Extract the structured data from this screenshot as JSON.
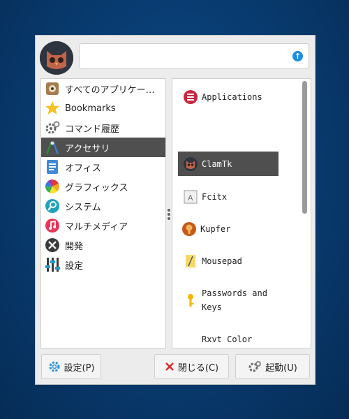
{
  "search": {
    "value": "",
    "placeholder": ""
  },
  "categories": [
    {
      "label": "すべてのアプリケー…",
      "icon": "all-apps-icon"
    },
    {
      "label": "Bookmarks",
      "icon": "star-icon"
    },
    {
      "label": "コマンド履歴",
      "icon": "gears-icon"
    },
    {
      "label": "アクセサリ",
      "icon": "accessories-icon",
      "selected": true
    },
    {
      "label": "オフィス",
      "icon": "office-icon"
    },
    {
      "label": "グラフィックス",
      "icon": "color-wheel-icon"
    },
    {
      "label": "システム",
      "icon": "magnifier-icon"
    },
    {
      "label": "マルチメディア",
      "icon": "music-note-icon"
    },
    {
      "label": "開発",
      "icon": "tools-icon"
    },
    {
      "label": "設定",
      "icon": "sliders-icon"
    }
  ],
  "apps": [
    {
      "label": "Applications",
      "icon": "applications-icon"
    },
    {
      "label": "ClamTk",
      "icon": "clamtk-icon",
      "selected": true
    },
    {
      "label": "Fcitx",
      "icon": "fcitx-icon"
    },
    {
      "label": "Kupfer",
      "icon": "kupfer-icon"
    },
    {
      "label": "Mousepad",
      "icon": "mousepad-icon"
    },
    {
      "label": "Passwords and Keys",
      "icon": "key-icon"
    },
    {
      "label": "Rxvt Color Unicode Terminal",
      "icon": "terminal-icon"
    }
  ],
  "buttons": {
    "settings": "設定(P)",
    "close": "閉じる(C)",
    "launch": "起動(U)"
  }
}
